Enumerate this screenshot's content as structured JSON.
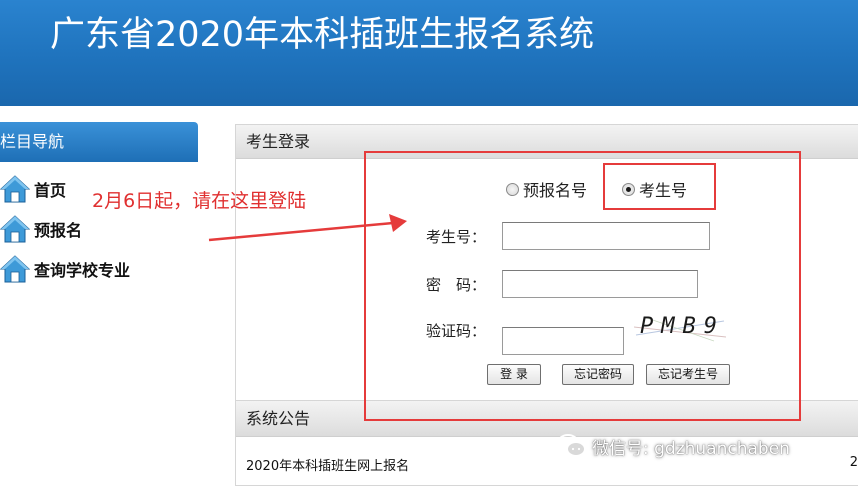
{
  "banner": {
    "title": "广东省2020年本科插班生报名系统"
  },
  "sidebar": {
    "header": "栏目导航",
    "items": [
      {
        "label": "首页",
        "icon": "home-icon"
      },
      {
        "label": "预报名",
        "icon": "home-icon"
      },
      {
        "label": "查询学校专业",
        "icon": "home-icon"
      }
    ]
  },
  "login": {
    "header": "考生登录",
    "radio_options": [
      {
        "label": "预报名号",
        "checked": false
      },
      {
        "label": "考生号",
        "checked": true
      }
    ],
    "fields": [
      {
        "label": "考生号：",
        "value": ""
      },
      {
        "label": "密　码：",
        "value": ""
      },
      {
        "label": "验证码：",
        "value": ""
      }
    ],
    "captcha_text": "PMB9",
    "buttons": {
      "login": "登 录",
      "forgot_password": "忘记密码",
      "forgot_exam_no": "忘记考生号"
    }
  },
  "notice": {
    "header": "系统公告",
    "items": [
      {
        "title": "2020年本科插班生网上报名",
        "date": "2"
      }
    ]
  },
  "annotation": {
    "text": "2月6日起，请在这里登陆"
  },
  "watermark": {
    "text": "微信号: gdzhuanchaben"
  },
  "colors": {
    "banner_blue": "#1f73bd",
    "nav_header_blue": "#1e6fb6",
    "annotation_red": "#e53b3b"
  }
}
